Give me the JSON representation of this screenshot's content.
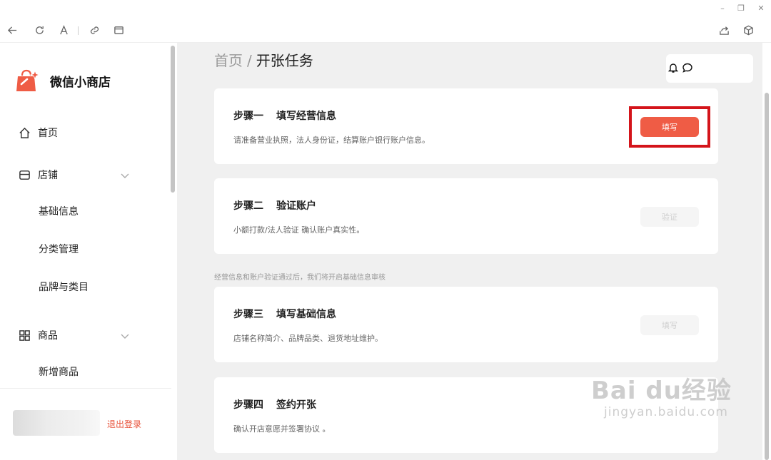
{
  "window": {
    "minimize": "–",
    "restore": "❐",
    "close": "✕"
  },
  "toolbar": {
    "icons": [
      "back-arrow-icon",
      "refresh-icon",
      "font-icon",
      "link-icon",
      "layout-icon",
      "share-icon",
      "cube-icon"
    ]
  },
  "sidebar": {
    "brand": "微信小商店",
    "nav": {
      "home": "首页",
      "store": "店铺",
      "store_sub": [
        "基础信息",
        "分类管理",
        "品牌与类目"
      ],
      "goods": "商品",
      "goods_sub": [
        "新增商品"
      ]
    },
    "logout": "退出登录"
  },
  "main": {
    "breadcrumb": {
      "home": "首页",
      "sep": "/",
      "current": "开张任务"
    },
    "steps": [
      {
        "step": "步骤一",
        "title": "填写经营信息",
        "desc": "请准备营业执照，法人身份证，结算账户银行账户信息。",
        "button": "填写",
        "enabled": true
      },
      {
        "step": "步骤二",
        "title": "验证账户",
        "desc": "小额打款/法人验证 确认账户真实性。",
        "button": "验证",
        "enabled": false
      },
      {
        "step": "步骤三",
        "title": "填写基础信息",
        "desc": "店铺名称简介、品牌品类、退货地址维护。",
        "button": "填写",
        "enabled": false
      },
      {
        "step": "步骤四",
        "title": "签约开张",
        "desc": "确认开店意愿并签署协议 。"
      }
    ],
    "note": "经营信息和账户验证通过后，我们将开启基础信息审核"
  },
  "watermark": {
    "main": "Bai du经验",
    "sub": "jingyan.baidu.com"
  },
  "colors": {
    "accent": "#ef5c45",
    "highlight": "#d4141a",
    "logout": "#e8533b",
    "background": "#f0f0f0"
  }
}
